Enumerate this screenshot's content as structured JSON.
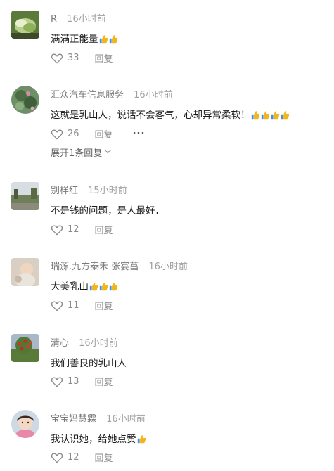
{
  "comments": [
    {
      "name": "R",
      "time": "16小时前",
      "text": "满满正能量",
      "thumbs": 2,
      "likes": "33",
      "reply": "回复",
      "avatar": "cabbage-avatar"
    },
    {
      "name": "汇众汽车信息服务",
      "time": "16小时前",
      "text": "这就是乳山人，说话不会客气，心却异常柔软！",
      "thumbs": 4,
      "likes": "26",
      "reply": "回复",
      "more": "···",
      "expand": "展开1条回复",
      "avatar": "lotus-avatar"
    },
    {
      "name": "别样红",
      "time": "15小时前",
      "text": "不是钱的问题，是人最好．",
      "thumbs": 0,
      "likes": "12",
      "reply": "回复",
      "avatar": "landscape-avatar"
    },
    {
      "name": "瑞源.九方泰禾 张宴菖",
      "time": "16小时前",
      "text": "大美乳山",
      "thumbs": 3,
      "likes": "11",
      "reply": "回复",
      "avatar": "baby-avatar"
    },
    {
      "name": "清心",
      "time": "16小时前",
      "text": "我们善良的乳山人",
      "thumbs": 0,
      "likes": "13",
      "reply": "回复",
      "avatar": "fruit-tree-avatar"
    },
    {
      "name": "宝宝妈慧霖",
      "time": "16小时前",
      "text": "我认识她，给她点赞",
      "thumbs": 1,
      "likes": "12",
      "reply": "回复",
      "avatar": "child-avatar"
    }
  ],
  "colors": {
    "meta": "#8a8a8a",
    "text": "#1a1a1a",
    "thumb": "#f2b51c"
  }
}
